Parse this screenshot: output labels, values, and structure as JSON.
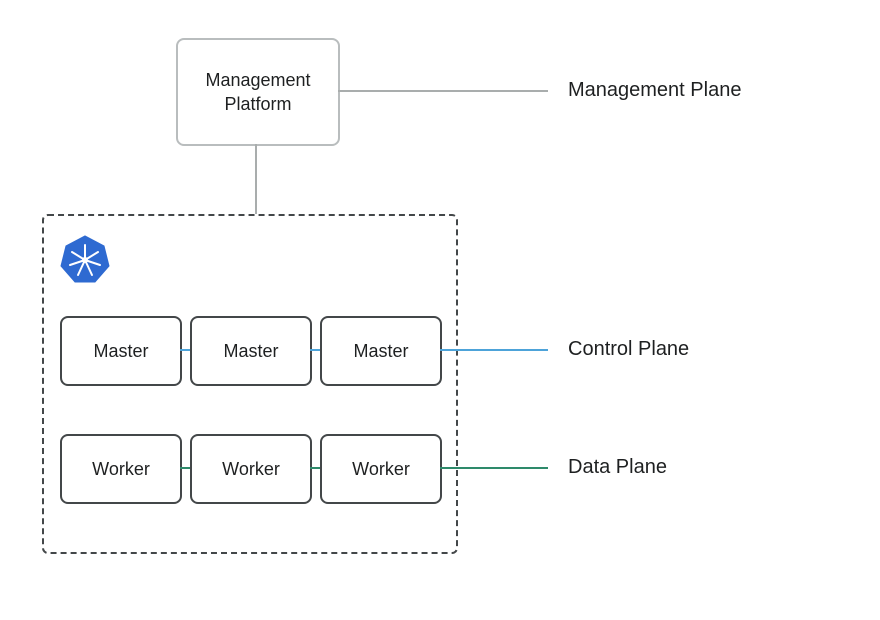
{
  "management_platform": {
    "label": "Management\nPlatform"
  },
  "planes": {
    "management": "Management Plane",
    "control": "Control Plane",
    "data": "Data Plane"
  },
  "cluster": {
    "masters": [
      "Master",
      "Master",
      "Master"
    ],
    "workers": [
      "Worker",
      "Worker",
      "Worker"
    ]
  },
  "icons": {
    "kubernetes": "kubernetes-icon"
  },
  "colors": {
    "box_border": "#434749",
    "soft_border": "#b9bdbe",
    "connector_gray": "#a9adad",
    "connector_blue": "#4da3d9",
    "connector_green": "#2e8a6b"
  }
}
